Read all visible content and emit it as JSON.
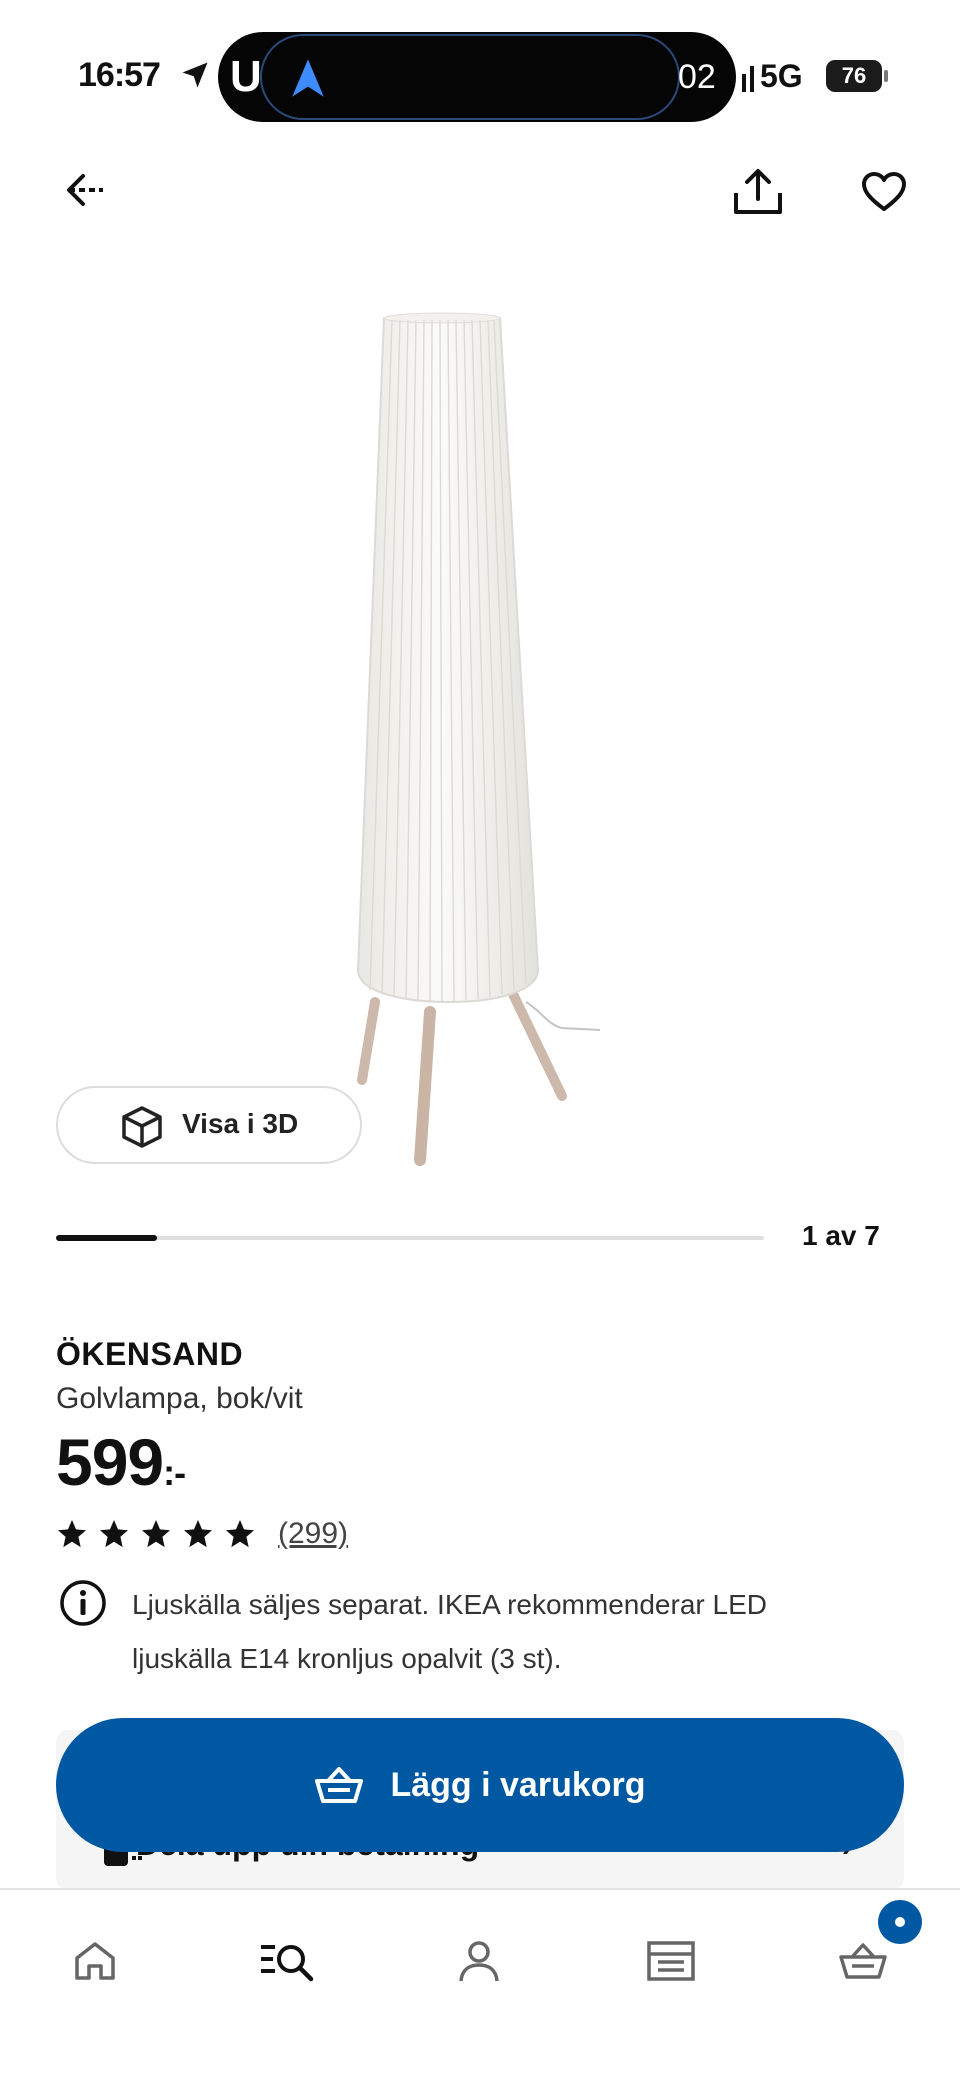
{
  "status_bar": {
    "time": "16:57",
    "island_letter": "U",
    "island_value": "02",
    "network": "5G",
    "battery": "76"
  },
  "header": {
    "back_icon": "back-arrow-icon",
    "share_icon": "share-icon",
    "favorite_icon": "heart-icon"
  },
  "gallery": {
    "view_3d_label": "Visa i 3D",
    "page_indicator": "1 av 7",
    "current_page": 1,
    "total_pages": 7
  },
  "product": {
    "name": "ÖKENSAND",
    "description": "Golvlampa, bok/vit",
    "price": "599",
    "price_suffix": ":-",
    "rating_stars": 5,
    "review_count": "(299)",
    "info_text": "Ljuskälla säljes separat. IKEA rekommenderar LED ljuskälla E14 kronljus opalvit (3 st)."
  },
  "actions": {
    "add_to_cart_label": "Lägg i varukorg",
    "hidden_card_text": "Dela upp din betalning"
  },
  "tab_bar": {
    "items": [
      {
        "name": "home",
        "icon": "home-icon"
      },
      {
        "name": "search",
        "icon": "search-icon"
      },
      {
        "name": "profile",
        "icon": "profile-icon"
      },
      {
        "name": "store",
        "icon": "store-icon"
      },
      {
        "name": "cart",
        "icon": "cart-icon"
      }
    ],
    "active": "search"
  },
  "colors": {
    "brand_blue": "#0058a3",
    "text": "#111111",
    "muted": "#333333"
  }
}
